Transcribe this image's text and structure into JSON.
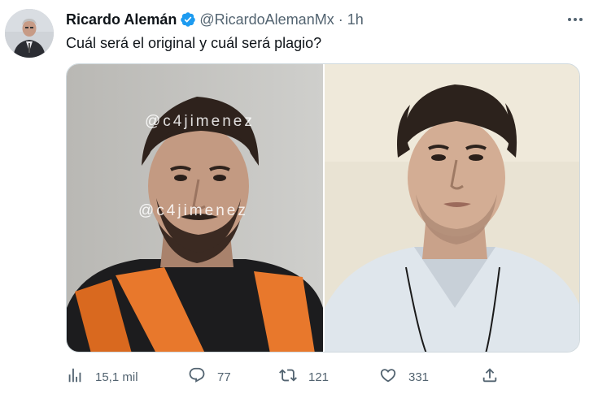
{
  "author": {
    "name": "Ricardo Alemán",
    "handle": "@RicardoAlemanMx",
    "separator": "·",
    "time": "1h",
    "verified": true,
    "avatar_icon": "avatar"
  },
  "tweet": {
    "text": "Cuál será el original y cuál será plagio?"
  },
  "media": {
    "watermark_1": "@c4jimenez",
    "watermark_2": "@c4jimenez"
  },
  "actions": {
    "views": "15,1 mil",
    "replies": "77",
    "retweets": "121",
    "likes": "331"
  },
  "colors": {
    "text_primary": "#0f1419",
    "text_secondary": "#536471",
    "verified_blue": "#1d9bf0",
    "border": "#cfd9de",
    "vest_orange": "#e8782c"
  },
  "icons": [
    "verified-badge-icon",
    "more-options-icon",
    "views-icon",
    "reply-icon",
    "retweet-icon",
    "like-icon",
    "share-icon"
  ]
}
